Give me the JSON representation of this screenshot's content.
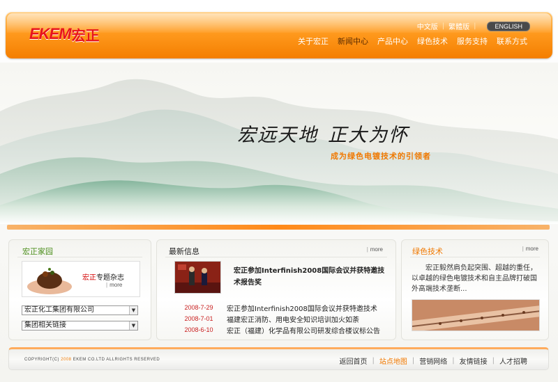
{
  "brand": {
    "logo_en": "EKEM",
    "logo_cn": "宏正"
  },
  "lang": {
    "cn": "中文版",
    "tw": "繁體版",
    "en": "ENGLISH"
  },
  "nav": [
    {
      "label": "关于宏正",
      "active": false
    },
    {
      "label": "新闻中心",
      "active": true
    },
    {
      "label": "产品中心",
      "active": false
    },
    {
      "label": "绿色技术",
      "active": false
    },
    {
      "label": "服务支持",
      "active": false
    },
    {
      "label": "联系方式",
      "active": false
    }
  ],
  "banner": {
    "slogan_a": "宏远天地",
    "slogan_b": "正大为怀",
    "subslogan": "成为绿色电镀技术的引领者"
  },
  "family": {
    "title": "宏正家园",
    "magazine_red": "宏正",
    "magazine_rest": "专题杂志",
    "magazine_more": "more",
    "select1": "宏正化工集团有限公司",
    "select2": "集团相关链接"
  },
  "news": {
    "title": "最新信息",
    "more": "more",
    "headline": "宏正参加Interfinish2008国际会议并获特邀技术报告奖",
    "items": [
      {
        "date": "2008-7-29",
        "title": "宏正参加Interfinish2008国际会议并获特邀技术"
      },
      {
        "date": "2008-7-01",
        "title": "福建宏正消防、用电安全知识培训加火如荼"
      },
      {
        "date": "2008-6-10",
        "title": "宏正（福建）化学品有限公司研发综合楼议标公告"
      }
    ]
  },
  "green": {
    "title": "绿色技术",
    "more": "more",
    "text": "宏正毅然肩负起突围、超越的重任，以卓越的绿色电镀技术和自主品牌打破国外高端技术垄断..."
  },
  "footer": {
    "copy_pre": "COPYRIGHT(C)",
    "copy_year": "2008",
    "copy_post": "EKEM CO.LTD ALLRIGHTS RESERVED",
    "links": [
      {
        "label": "返回首页",
        "highlight": false
      },
      {
        "label": "站点地图",
        "highlight": true
      },
      {
        "label": "营销网络",
        "highlight": false
      },
      {
        "label": "友情链接",
        "highlight": false
      },
      {
        "label": "人才招聘",
        "highlight": false
      }
    ]
  },
  "colors": {
    "accent": "#f47e00",
    "logo": "#e8141b",
    "green": "#4a8d1a",
    "date": "#c81e1e"
  }
}
